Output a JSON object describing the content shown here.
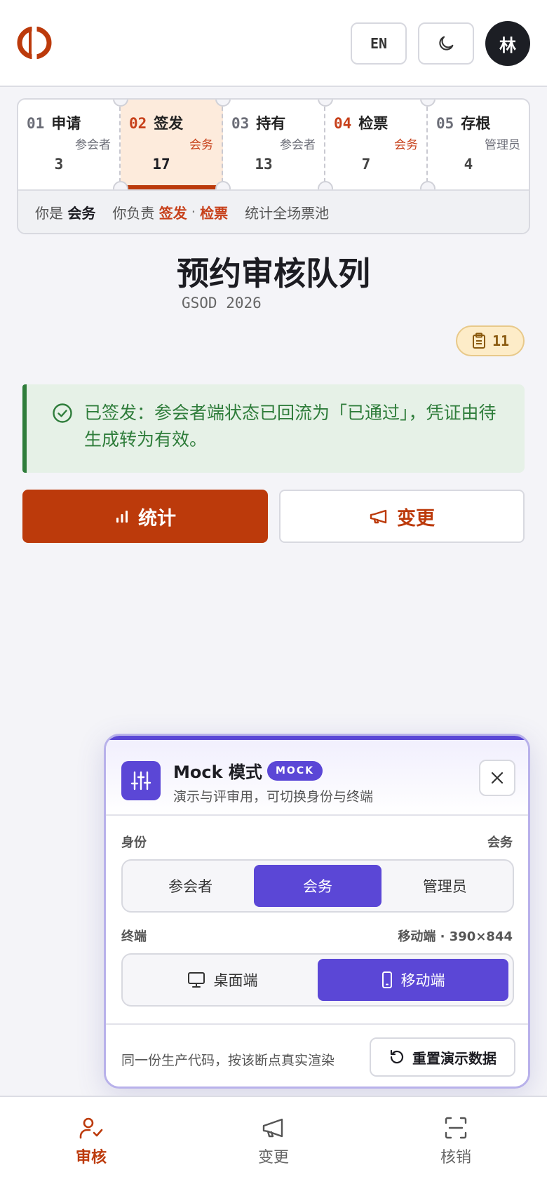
{
  "header": {
    "lang_label": "EN",
    "avatar_initial": "林"
  },
  "pipeline": {
    "stages": [
      {
        "num": "01",
        "name": "申请",
        "role": "参会者",
        "count": "3"
      },
      {
        "num": "02",
        "name": "签发",
        "role": "会务",
        "count": "17"
      },
      {
        "num": "03",
        "name": "持有",
        "role": "参会者",
        "count": "13"
      },
      {
        "num": "04",
        "name": "检票",
        "role": "会务",
        "count": "7"
      },
      {
        "num": "05",
        "name": "存根",
        "role": "管理员",
        "count": "4"
      }
    ],
    "footer": {
      "you_are": "你是",
      "role": "会务",
      "responsible": "你负责",
      "duty_1": "签发",
      "separator": "·",
      "duty_2": "检票",
      "stats_note": "统计全场票池"
    }
  },
  "page": {
    "title": "预约审核队列",
    "subtitle": "GSOD 2026",
    "badge_count": "11"
  },
  "alert": {
    "text": "已签发：参会者端状态已回流为「已通过」，凭证由待生成转为有效。"
  },
  "actions": {
    "primary_label": "统计",
    "secondary_label": "变更"
  },
  "mock": {
    "title": "Mock 模式",
    "tag": "MOCK",
    "description": "演示与评审用，可切换身份与终端",
    "identity_label": "身份",
    "identity_value": "会务",
    "identity_options": [
      "参会者",
      "会务",
      "管理员"
    ],
    "terminal_label": "终端",
    "terminal_value": "移动端 · 390×844",
    "terminal_options": [
      "桌面端",
      "移动端"
    ],
    "footer_text": "同一份生产代码，按该断点真实渲染",
    "reset_label": "重置演示数据"
  },
  "bottom_nav": {
    "items": [
      {
        "label": "审核"
      },
      {
        "label": "变更"
      },
      {
        "label": "核销"
      }
    ]
  },
  "colors": {
    "brand": "#bc3a0b",
    "mock_accent": "#5b47d6",
    "success": "#2f7d3b"
  }
}
